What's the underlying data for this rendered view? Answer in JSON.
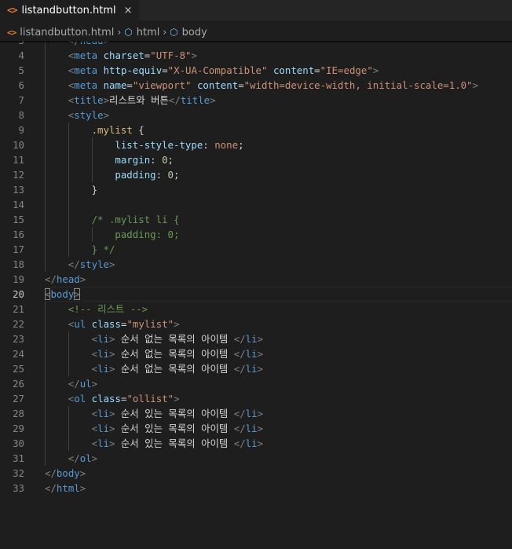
{
  "tab": {
    "icon": "<>",
    "label": "listandbutton.html",
    "close": "×"
  },
  "breadcrumb": {
    "file_icon": "<>",
    "file": "listandbutton.html",
    "items": [
      {
        "icon": "⬡",
        "label": "html"
      },
      {
        "icon": "⬡",
        "label": "body"
      }
    ]
  },
  "editor": {
    "lines": [
      {
        "n": "3",
        "indent": 1,
        "tokens": [
          [
            "bracket",
            "</"
          ],
          [
            "tag",
            "head"
          ],
          [
            "bracket",
            ">"
          ]
        ]
      },
      {
        "n": "4",
        "indent": 1,
        "tokens": [
          [
            "bracket",
            "<"
          ],
          [
            "tag",
            "meta"
          ],
          [
            "txt",
            " "
          ],
          [
            "attr",
            "charset"
          ],
          [
            "txt",
            "="
          ],
          [
            "str",
            "\"UTF-8\""
          ],
          [
            "bracket",
            ">"
          ]
        ]
      },
      {
        "n": "5",
        "indent": 1,
        "tokens": [
          [
            "bracket",
            "<"
          ],
          [
            "tag",
            "meta"
          ],
          [
            "txt",
            " "
          ],
          [
            "attr",
            "http-equiv"
          ],
          [
            "txt",
            "="
          ],
          [
            "str",
            "\"X-UA-Compatible\""
          ],
          [
            "txt",
            " "
          ],
          [
            "attr",
            "content"
          ],
          [
            "txt",
            "="
          ],
          [
            "str",
            "\"IE=edge\""
          ],
          [
            "bracket",
            ">"
          ]
        ]
      },
      {
        "n": "6",
        "indent": 1,
        "tokens": [
          [
            "bracket",
            "<"
          ],
          [
            "tag",
            "meta"
          ],
          [
            "txt",
            " "
          ],
          [
            "attr",
            "name"
          ],
          [
            "txt",
            "="
          ],
          [
            "str",
            "\"viewport\""
          ],
          [
            "txt",
            " "
          ],
          [
            "attr",
            "content"
          ],
          [
            "txt",
            "="
          ],
          [
            "str",
            "\"width=device-width, initial-scale=1.0\""
          ],
          [
            "bracket",
            ">"
          ]
        ]
      },
      {
        "n": "7",
        "indent": 1,
        "tokens": [
          [
            "bracket",
            "<"
          ],
          [
            "tag",
            "title"
          ],
          [
            "bracket",
            ">"
          ],
          [
            "txt",
            "리스트와 버튼"
          ],
          [
            "bracket",
            "</"
          ],
          [
            "tag",
            "title"
          ],
          [
            "bracket",
            ">"
          ]
        ]
      },
      {
        "n": "8",
        "indent": 1,
        "tokens": [
          [
            "bracket",
            "<"
          ],
          [
            "tag",
            "style"
          ],
          [
            "bracket",
            ">"
          ]
        ]
      },
      {
        "n": "9",
        "indent": 2,
        "tokens": [
          [
            "sel",
            ".mylist"
          ],
          [
            "txt",
            " {"
          ]
        ]
      },
      {
        "n": "10",
        "indent": 3,
        "tokens": [
          [
            "prop",
            "list-style-type"
          ],
          [
            "txt",
            ": "
          ],
          [
            "val",
            "none"
          ],
          [
            "txt",
            ";"
          ]
        ]
      },
      {
        "n": "11",
        "indent": 3,
        "tokens": [
          [
            "prop",
            "margin"
          ],
          [
            "txt",
            ": "
          ],
          [
            "num",
            "0"
          ],
          [
            "txt",
            ";"
          ]
        ]
      },
      {
        "n": "12",
        "indent": 3,
        "tokens": [
          [
            "prop",
            "padding"
          ],
          [
            "txt",
            ": "
          ],
          [
            "num",
            "0"
          ],
          [
            "txt",
            ";"
          ]
        ]
      },
      {
        "n": "13",
        "indent": 2,
        "tokens": [
          [
            "txt",
            "}"
          ]
        ]
      },
      {
        "n": "14",
        "indent": 0,
        "tokens": []
      },
      {
        "n": "15",
        "indent": 2,
        "tokens": [
          [
            "cmt",
            "/* .mylist li {"
          ]
        ]
      },
      {
        "n": "16",
        "indent": 3,
        "tokens": [
          [
            "cmt",
            "padding: 0;"
          ]
        ]
      },
      {
        "n": "17",
        "indent": 2,
        "tokens": [
          [
            "cmt",
            "} */"
          ]
        ]
      },
      {
        "n": "18",
        "indent": 1,
        "tokens": [
          [
            "bracket",
            "</"
          ],
          [
            "tag",
            "style"
          ],
          [
            "bracket",
            ">"
          ]
        ]
      },
      {
        "n": "19",
        "indent": 0,
        "tokens": [
          [
            "bracket",
            "</"
          ],
          [
            "tag",
            "head"
          ],
          [
            "bracket",
            ">"
          ]
        ]
      },
      {
        "n": "20",
        "indent": 0,
        "active": true,
        "tokens": [
          [
            "bracket",
            "<"
          ],
          [
            "tag",
            "body"
          ],
          [
            "bracket",
            ">"
          ]
        ]
      },
      {
        "n": "21",
        "indent": 1,
        "tokens": [
          [
            "cmt",
            "<!-- 리스트 -->"
          ]
        ]
      },
      {
        "n": "22",
        "indent": 1,
        "tokens": [
          [
            "bracket",
            "<"
          ],
          [
            "tag",
            "ul"
          ],
          [
            "txt",
            " "
          ],
          [
            "attr",
            "class"
          ],
          [
            "txt",
            "="
          ],
          [
            "str",
            "\"mylist\""
          ],
          [
            "bracket",
            ">"
          ]
        ]
      },
      {
        "n": "23",
        "indent": 2,
        "tokens": [
          [
            "bracket",
            "<"
          ],
          [
            "tag",
            "li"
          ],
          [
            "bracket",
            ">"
          ],
          [
            "txt",
            " 순서 없는 목록의 아이템 "
          ],
          [
            "bracket",
            "</"
          ],
          [
            "tag",
            "li"
          ],
          [
            "bracket",
            ">"
          ]
        ]
      },
      {
        "n": "24",
        "indent": 2,
        "tokens": [
          [
            "bracket",
            "<"
          ],
          [
            "tag",
            "li"
          ],
          [
            "bracket",
            ">"
          ],
          [
            "txt",
            " 순서 없는 목록의 아이템 "
          ],
          [
            "bracket",
            "</"
          ],
          [
            "tag",
            "li"
          ],
          [
            "bracket",
            ">"
          ]
        ]
      },
      {
        "n": "25",
        "indent": 2,
        "tokens": [
          [
            "bracket",
            "<"
          ],
          [
            "tag",
            "li"
          ],
          [
            "bracket",
            ">"
          ],
          [
            "txt",
            " 순서 없는 목록의 아이템 "
          ],
          [
            "bracket",
            "</"
          ],
          [
            "tag",
            "li"
          ],
          [
            "bracket",
            ">"
          ]
        ]
      },
      {
        "n": "26",
        "indent": 1,
        "tokens": [
          [
            "bracket",
            "</"
          ],
          [
            "tag",
            "ul"
          ],
          [
            "bracket",
            ">"
          ]
        ]
      },
      {
        "n": "27",
        "indent": 1,
        "tokens": [
          [
            "bracket",
            "<"
          ],
          [
            "tag",
            "ol"
          ],
          [
            "txt",
            " "
          ],
          [
            "attr",
            "class"
          ],
          [
            "txt",
            "="
          ],
          [
            "str",
            "\"ollist\""
          ],
          [
            "bracket",
            ">"
          ]
        ]
      },
      {
        "n": "28",
        "indent": 2,
        "tokens": [
          [
            "bracket",
            "<"
          ],
          [
            "tag",
            "li"
          ],
          [
            "bracket",
            ">"
          ],
          [
            "txt",
            " 순서 있는 목록의 아이템 "
          ],
          [
            "bracket",
            "</"
          ],
          [
            "tag",
            "li"
          ],
          [
            "bracket",
            ">"
          ]
        ]
      },
      {
        "n": "29",
        "indent": 2,
        "tokens": [
          [
            "bracket",
            "<"
          ],
          [
            "tag",
            "li"
          ],
          [
            "bracket",
            ">"
          ],
          [
            "txt",
            " 순서 있는 목록의 아이템 "
          ],
          [
            "bracket",
            "</"
          ],
          [
            "tag",
            "li"
          ],
          [
            "bracket",
            ">"
          ]
        ]
      },
      {
        "n": "30",
        "indent": 2,
        "tokens": [
          [
            "bracket",
            "<"
          ],
          [
            "tag",
            "li"
          ],
          [
            "bracket",
            ">"
          ],
          [
            "txt",
            " 순서 있는 목록의 아이템 "
          ],
          [
            "bracket",
            "</"
          ],
          [
            "tag",
            "li"
          ],
          [
            "bracket",
            ">"
          ]
        ]
      },
      {
        "n": "31",
        "indent": 1,
        "tokens": [
          [
            "bracket",
            "</"
          ],
          [
            "tag",
            "ol"
          ],
          [
            "bracket",
            ">"
          ]
        ]
      },
      {
        "n": "32",
        "indent": 0,
        "tokens": [
          [
            "bracket",
            "</"
          ],
          [
            "tag",
            "body"
          ],
          [
            "bracket",
            ">"
          ]
        ]
      },
      {
        "n": "33",
        "indent": 0,
        "tokens": [
          [
            "bracket",
            "</"
          ],
          [
            "tag",
            "html"
          ],
          [
            "bracket",
            ">"
          ]
        ]
      }
    ]
  }
}
